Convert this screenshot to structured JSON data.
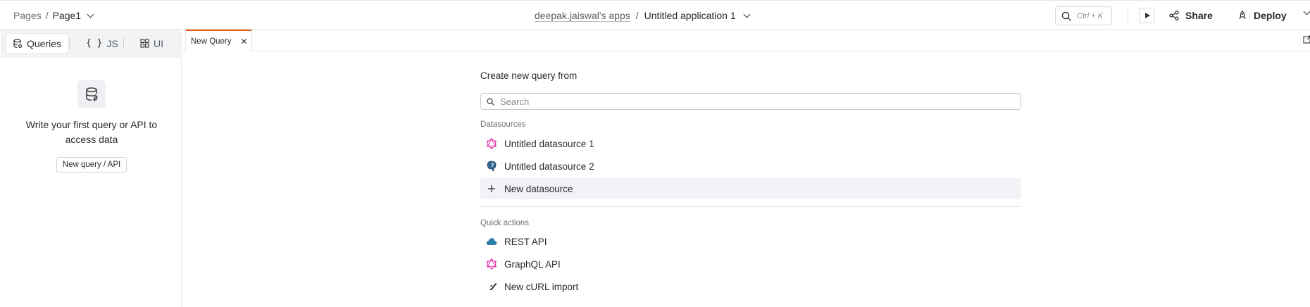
{
  "header": {
    "pages_label": "Pages",
    "separator": "/",
    "current_page": "Page1",
    "workspace_link": "deepak.jaiswal's apps",
    "app_separator": "/",
    "app_name": "Untitled application 1",
    "search_shortcut": "Ctrl + K",
    "share_label": "Share",
    "deploy_label": "Deploy"
  },
  "sidebar": {
    "tabs": [
      {
        "label": "Queries",
        "icon": "database-icon",
        "active": true
      },
      {
        "label": "JS",
        "icon": "braces-icon",
        "active": false
      },
      {
        "label": "UI",
        "icon": "widgets-icon",
        "active": false
      }
    ],
    "empty_message": "Write your first query or API to access data",
    "new_button_label": "New query / API"
  },
  "editor": {
    "tab_label": "New Query"
  },
  "create": {
    "title": "Create new query from",
    "search_placeholder": "Search",
    "datasources_label": "Datasources",
    "datasources": [
      {
        "label": "Untitled datasource 1",
        "icon": "graphql-icon"
      },
      {
        "label": "Untitled datasource 2",
        "icon": "postgres-icon"
      },
      {
        "label": "New datasource",
        "icon": "plus-icon"
      }
    ],
    "quick_actions_label": "Quick actions",
    "quick_actions": [
      {
        "label": "REST API",
        "icon": "cloud-icon"
      },
      {
        "label": "GraphQL API",
        "icon": "graphql-icon"
      },
      {
        "label": "New cURL import",
        "icon": "curl-icon"
      }
    ]
  },
  "colors": {
    "accent": "#e15615",
    "graphql": "#e535ab",
    "rest_cloud": "#2b7ea8",
    "postgres": "#336791"
  }
}
